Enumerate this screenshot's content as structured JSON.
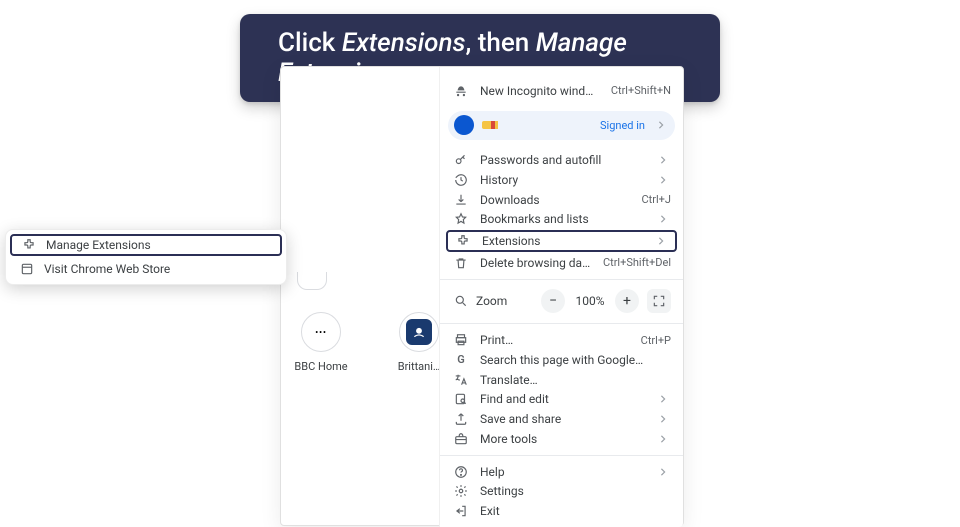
{
  "banner": {
    "prefix": "Click ",
    "em1": "Extensions",
    "mid": ", then ",
    "em2": "Manage Extensions"
  },
  "tiles": {
    "bbc": "BBC Home",
    "brit": "Brittani…"
  },
  "submenu": {
    "manage": "Manage Extensions",
    "store": "Visit Chrome Web Store"
  },
  "menu": {
    "incognito": {
      "label": "New Incognito window",
      "shortcut": "Ctrl+Shift+N"
    },
    "signed_in": "Signed in",
    "passwords": "Passwords and autofill",
    "history": "History",
    "downloads": {
      "label": "Downloads",
      "shortcut": "Ctrl+J"
    },
    "bookmarks": "Bookmarks and lists",
    "extensions": "Extensions",
    "delete": {
      "label": "Delete browsing data…",
      "shortcut": "Ctrl+Shift+Del"
    },
    "zoom": {
      "label": "Zoom",
      "value": "100%"
    },
    "print": {
      "label": "Print…",
      "shortcut": "Ctrl+P"
    },
    "gsearch": "Search this page with Google…",
    "translate": "Translate…",
    "find": "Find and edit",
    "save": "Save and share",
    "tools": "More tools",
    "help": "Help",
    "settings": "Settings",
    "exit": "Exit"
  }
}
